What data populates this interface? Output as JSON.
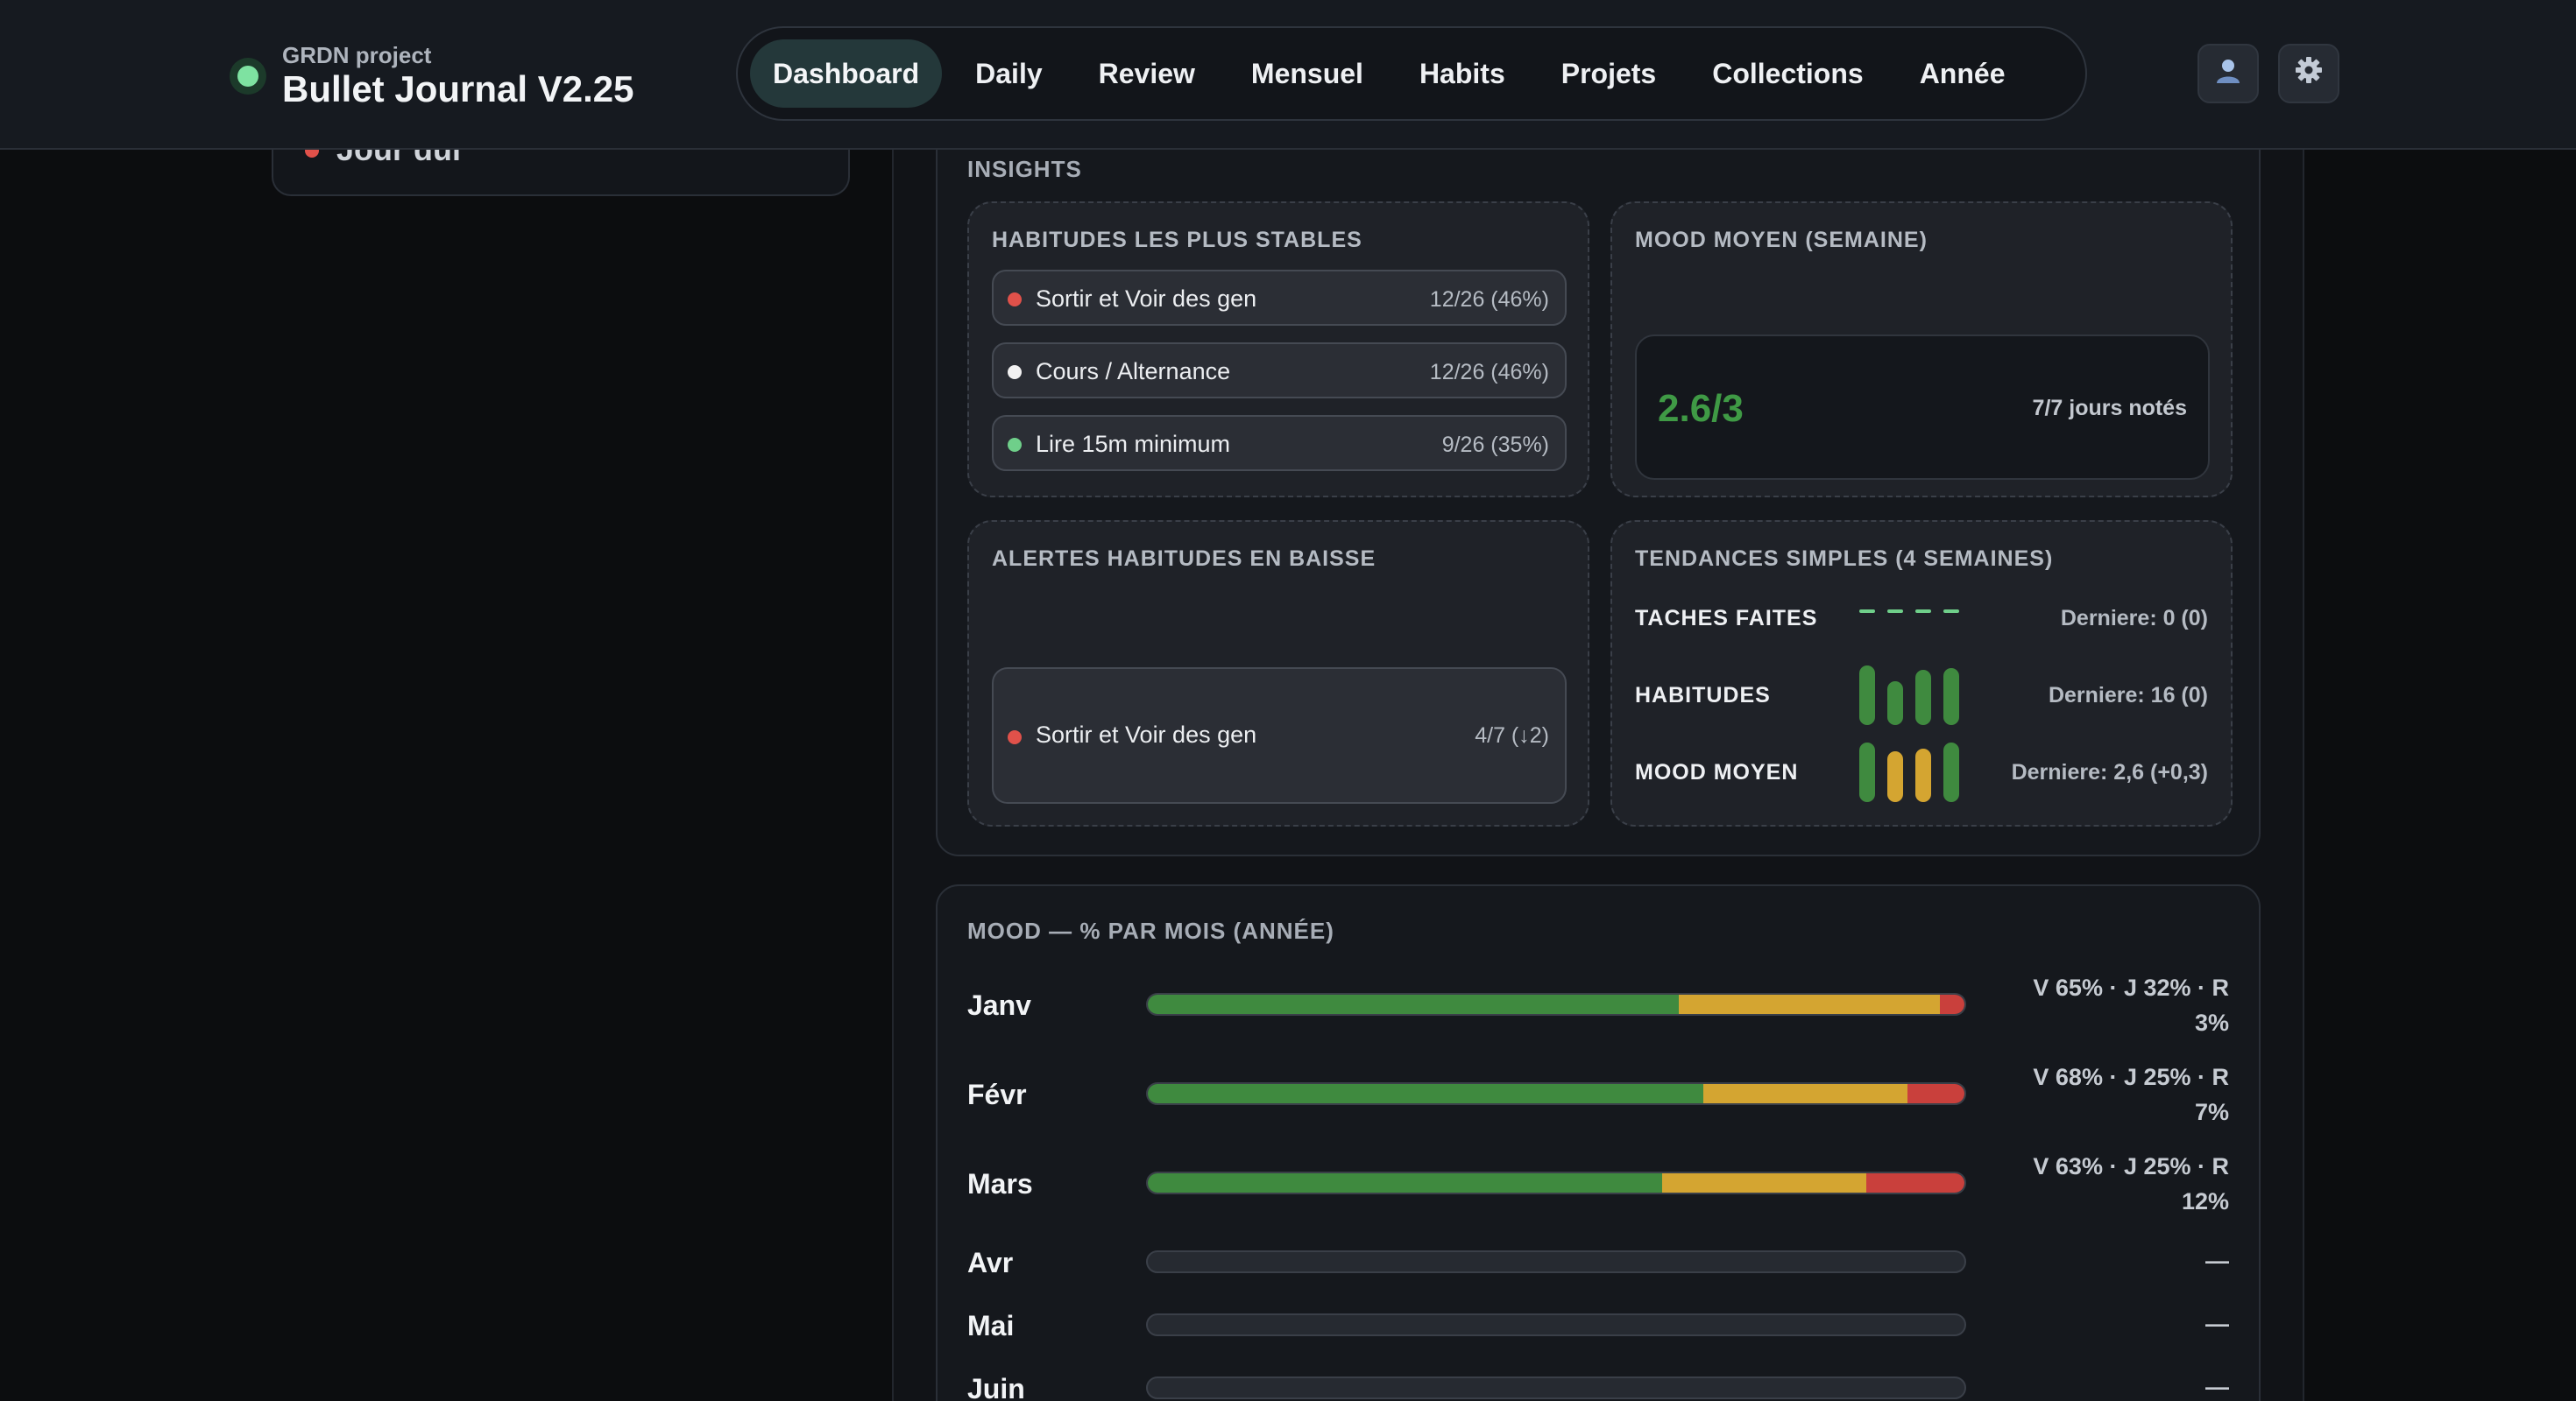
{
  "header": {
    "project": "GRDN project",
    "title": "Bullet Journal V2.25",
    "nav": [
      "Dashboard",
      "Daily",
      "Review",
      "Mensuel",
      "Habits",
      "Projets",
      "Collections",
      "Année"
    ],
    "active_nav": "Dashboard",
    "user_icon": "user-icon",
    "settings_icon": "gear-icon"
  },
  "sidebar": {
    "partial_item": "Jour dui"
  },
  "insights": {
    "label": "INSIGHTS",
    "stable": {
      "title": "HABITUDES LES PLUS STABLES",
      "items": [
        {
          "label": "Sortir et Voir des gen",
          "value": "12/26 (46%)",
          "color": "#e0514a"
        },
        {
          "label": "Cours / Alternance",
          "value": "12/26 (46%)",
          "color": "#f2f2f2"
        },
        {
          "label": "Lire 15m minimum",
          "value": "9/26 (35%)",
          "color": "#6fcf8a"
        }
      ]
    },
    "mood_week": {
      "title": "MOOD MOYEN (SEMAINE)",
      "value": "2.6/3",
      "note": "7/7 jours notés"
    },
    "alerts": {
      "title": "ALERTES HABITUDES EN BAISSE",
      "items": [
        {
          "label": "Sortir et Voir des gen",
          "value": "4/7 (↓2)",
          "color": "#e0514a"
        }
      ]
    },
    "trends": {
      "title": "TENDANCES SIMPLES (4 SEMAINES)",
      "rows": [
        {
          "label": "TACHES FAITES",
          "last": "Derniere: 0 (0)",
          "bars": [
            0,
            0,
            0,
            0
          ],
          "colors": [
            "#6fcf8a",
            "#6fcf8a",
            "#6fcf8a",
            "#6fcf8a"
          ]
        },
        {
          "label": "HABITUDES",
          "last": "Derniere: 16 (0)",
          "bars": [
            0.95,
            0.7,
            0.88,
            0.9
          ],
          "colors": [
            "#3f8a3f",
            "#3f8a3f",
            "#3f8a3f",
            "#3f8a3f"
          ]
        },
        {
          "label": "MOOD MOYEN",
          "last": "Derniere: 2,6 (+0,3)",
          "bars": [
            0.95,
            0.8,
            0.85,
            0.95
          ],
          "colors": [
            "#3f8a3f",
            "#d4a531",
            "#d4a531",
            "#3f8a3f"
          ]
        }
      ]
    }
  },
  "mood_year": {
    "title": "MOOD — % PAR MOIS (ANNÉE)",
    "colors": {
      "v": "#3f8a3f",
      "j": "#d4a531",
      "r": "#c9403c"
    },
    "months": [
      {
        "name": "Janv",
        "v": 65,
        "j": 32,
        "r": 3,
        "text": "V 65% · J 32% · R 3%"
      },
      {
        "name": "Févr",
        "v": 68,
        "j": 25,
        "r": 7,
        "text": "V 68% · J 25% · R 7%"
      },
      {
        "name": "Mars",
        "v": 63,
        "j": 25,
        "r": 12,
        "text": "V 63% · J 25% · R 12%"
      },
      {
        "name": "Avr",
        "v": 0,
        "j": 0,
        "r": 0,
        "text": "—"
      },
      {
        "name": "Mai",
        "v": 0,
        "j": 0,
        "r": 0,
        "text": "—"
      },
      {
        "name": "Juin",
        "v": 0,
        "j": 0,
        "r": 0,
        "text": "—"
      }
    ]
  }
}
